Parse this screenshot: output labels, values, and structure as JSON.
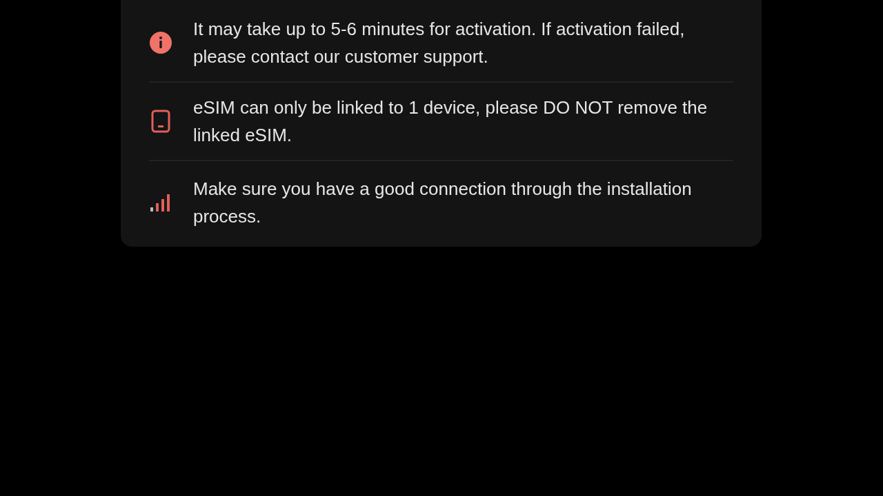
{
  "notes": [
    {
      "kind": "info",
      "text": "It may take up to 5-6 minutes for activation. If activation failed, please contact our customer support."
    },
    {
      "kind": "device",
      "text": "eSIM can only be linked to 1 device, please DO NOT remove the linked eSIM."
    },
    {
      "kind": "signal",
      "text": "Make sure you have a good connection through the installation process."
    }
  ]
}
